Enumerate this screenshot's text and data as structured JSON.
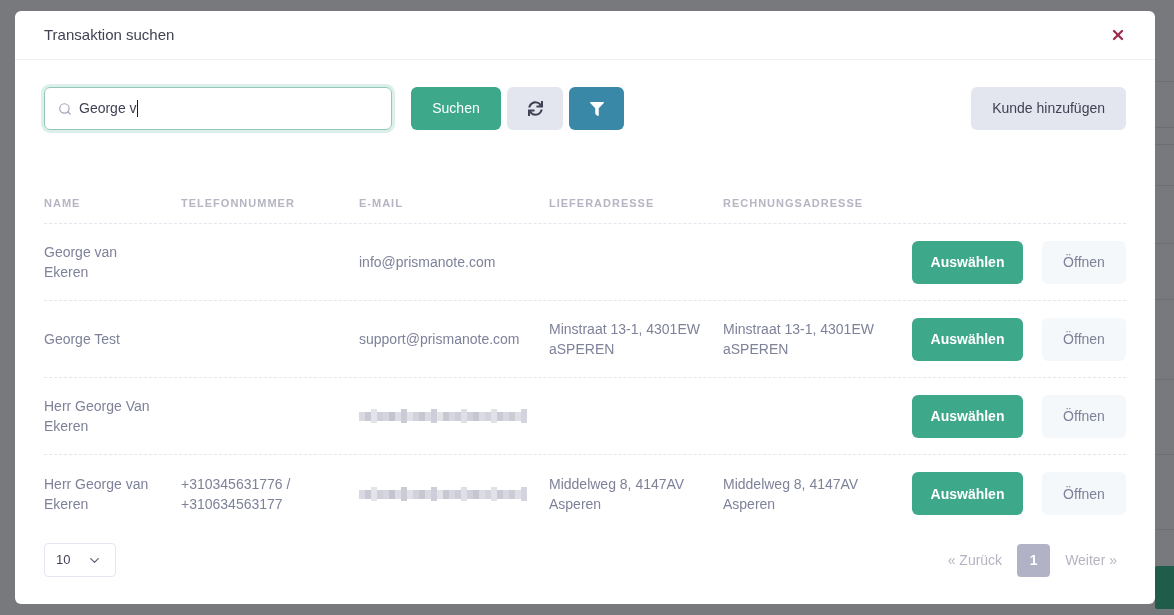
{
  "dialog": {
    "title": "Transaktion suchen",
    "search": {
      "value": "George v",
      "focused": true
    },
    "toolbar_buttons": [
      {
        "kind": "primary",
        "label": "Suchen"
      },
      {
        "kind": "refresh"
      },
      {
        "kind": "filter"
      }
    ],
    "add_button": {
      "label": "Kunde hinzufügen"
    },
    "table": {
      "columns": [
        "NAME",
        "TELEFONNUMMER",
        "E-MAIL",
        "LIEFERADRESSE",
        "RECHNUNGSADRESSE"
      ],
      "rows": [
        {
          "name": "George van Ekeren",
          "email": "info@prismanote.com",
          "email_blurred": false,
          "select_label": "Auswählen",
          "open_label": "Öffnen"
        },
        {
          "name": "George Test",
          "email": "support@prismanote.com",
          "email_blurred": false,
          "delivery_address": "Minstraat 13-1, 4301EW aSPEREN",
          "billing_address": "Minstraat 13-1, 4301EW aSPEREN",
          "select_label": "Auswählen",
          "open_label": "Öffnen"
        },
        {
          "name": "Herr George Van Ekeren",
          "email_blurred": true,
          "select_label": "Auswählen",
          "open_label": "Öffnen"
        },
        {
          "name": "Herr George van Ekeren",
          "phone": "+310345631776 / +310634563177",
          "email_blurred": true,
          "delivery_address": "Middelweg 8, 4147AV Asperen",
          "billing_address": "Middelweg 8, 4147AV Asperen",
          "select_label": "Auswählen",
          "open_label": "Öffnen"
        }
      ]
    },
    "page_size": {
      "value": "10"
    },
    "pagination": {
      "previous": {
        "label": "« Zurück",
        "disabled": true
      },
      "pages": [
        {
          "label": "1",
          "selected": true
        }
      ],
      "next": {
        "label": "Weiter »",
        "disabled": true
      }
    }
  }
}
